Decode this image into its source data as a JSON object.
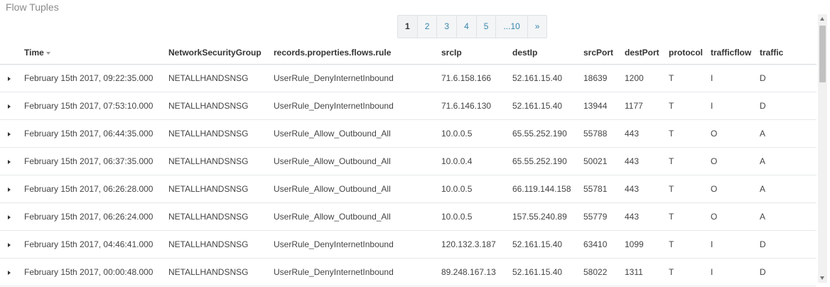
{
  "panel": {
    "title": "Flow Tuples"
  },
  "pagination": {
    "pages": [
      "1",
      "2",
      "3",
      "4",
      "5",
      "...10",
      "»"
    ],
    "active": "1"
  },
  "table": {
    "columns": [
      "Time",
      "NetworkSecurityGroup",
      "records.properties.flows.rule",
      "srcIp",
      "destIp",
      "srcPort",
      "destPort",
      "protocol",
      "trafficflow",
      "traffic"
    ],
    "rows": [
      [
        "February 15th 2017, 09:22:35.000",
        "NETALLHANDSNSG",
        "UserRule_DenyInternetInbound",
        "71.6.158.166",
        "52.161.15.40",
        "18639",
        "1200",
        "T",
        "I",
        "D"
      ],
      [
        "February 15th 2017, 07:53:10.000",
        "NETALLHANDSNSG",
        "UserRule_DenyInternetInbound",
        "71.6.146.130",
        "52.161.15.40",
        "13944",
        "1177",
        "T",
        "I",
        "D"
      ],
      [
        "February 15th 2017, 06:44:35.000",
        "NETALLHANDSNSG",
        "UserRule_Allow_Outbound_All",
        "10.0.0.5",
        "65.55.252.190",
        "55788",
        "443",
        "T",
        "O",
        "A"
      ],
      [
        "February 15th 2017, 06:37:35.000",
        "NETALLHANDSNSG",
        "UserRule_Allow_Outbound_All",
        "10.0.0.4",
        "65.55.252.190",
        "50021",
        "443",
        "T",
        "O",
        "A"
      ],
      [
        "February 15th 2017, 06:26:28.000",
        "NETALLHANDSNSG",
        "UserRule_Allow_Outbound_All",
        "10.0.0.5",
        "66.119.144.158",
        "55781",
        "443",
        "T",
        "O",
        "A"
      ],
      [
        "February 15th 2017, 06:26:24.000",
        "NETALLHANDSNSG",
        "UserRule_Allow_Outbound_All",
        "10.0.0.5",
        "157.55.240.89",
        "55779",
        "443",
        "T",
        "O",
        "A"
      ],
      [
        "February 15th 2017, 04:46:41.000",
        "NETALLHANDSNSG",
        "UserRule_DenyInternetInbound",
        "120.132.3.187",
        "52.161.15.40",
        "63410",
        "1099",
        "T",
        "I",
        "D"
      ],
      [
        "February 15th 2017, 00:00:48.000",
        "NETALLHANDSNSG",
        "UserRule_DenyInternetInbound",
        "89.248.167.13",
        "52.161.15.40",
        "58022",
        "1311",
        "T",
        "I",
        "D"
      ]
    ]
  },
  "icons": {
    "expand": "caret-right-icon",
    "sort": "sort-desc-icon"
  }
}
